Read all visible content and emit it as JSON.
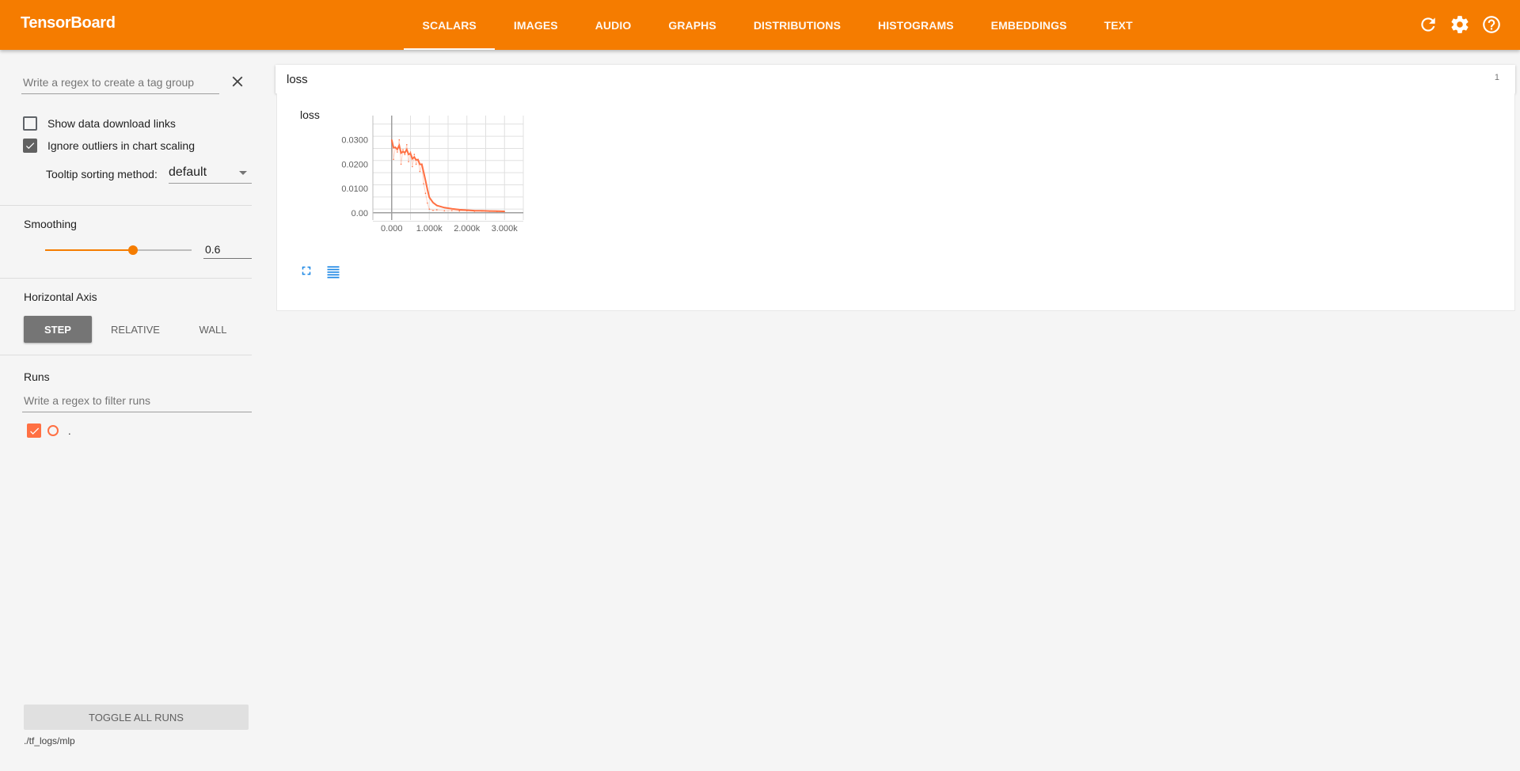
{
  "header": {
    "brand": "TensorBoard",
    "tabs": [
      {
        "label": "SCALARS",
        "active": true
      },
      {
        "label": "IMAGES"
      },
      {
        "label": "AUDIO"
      },
      {
        "label": "GRAPHS"
      },
      {
        "label": "DISTRIBUTIONS"
      },
      {
        "label": "HISTOGRAMS"
      },
      {
        "label": "EMBEDDINGS"
      },
      {
        "label": "TEXT"
      }
    ],
    "icons": [
      "refresh-icon",
      "settings-gear-icon",
      "help-icon"
    ]
  },
  "sidebar": {
    "tag_group_placeholder": "Write a regex to create a tag group",
    "show_download_links": {
      "label": "Show data download links",
      "checked": false
    },
    "ignore_outliers": {
      "label": "Ignore outliers in chart scaling",
      "checked": true
    },
    "tooltip_sorting": {
      "label": "Tooltip sorting method:",
      "value": "default"
    },
    "smoothing": {
      "label": "Smoothing",
      "value": "0.6",
      "fraction": 0.6
    },
    "horizontal_axis": {
      "label": "Horizontal Axis",
      "options": [
        "STEP",
        "RELATIVE",
        "WALL"
      ],
      "selected": "STEP"
    },
    "runs": {
      "label": "Runs",
      "filter_placeholder": "Write a regex to filter runs",
      "items": [
        {
          "name": ".",
          "checked": true,
          "color": "#ff7043"
        }
      ]
    },
    "toggle_all_runs": "TOGGLE ALL RUNS",
    "logdir": "./tf_logs/mlp"
  },
  "main": {
    "category": {
      "title": "loss",
      "count": "1"
    },
    "card": {
      "title": "loss"
    }
  },
  "colors": {
    "accent": "#f57c00",
    "run": "#ff7043"
  },
  "chart_data": {
    "type": "line",
    "title": "loss",
    "xlabel": "",
    "ylabel": "",
    "x_ticks": [
      "0.000",
      "1.000k",
      "2.000k",
      "3.000k"
    ],
    "y_ticks": [
      "0.00",
      "0.0100",
      "0.0200",
      "0.0300"
    ],
    "xlim": [
      -500,
      3500
    ],
    "ylim": [
      -0.003,
      0.04
    ],
    "grid": true,
    "series": [
      {
        "name": ".",
        "x": [
          0,
          50,
          100,
          150,
          200,
          250,
          300,
          350,
          400,
          450,
          500,
          550,
          600,
          650,
          700,
          750,
          800,
          850,
          900,
          950,
          1000,
          1100,
          1200,
          1400,
          1600,
          1800,
          2000,
          2200,
          2400,
          2600,
          2800,
          3000
        ],
        "y": [
          0.03,
          0.022,
          0.027,
          0.025,
          0.03,
          0.02,
          0.026,
          0.024,
          0.028,
          0.021,
          0.025,
          0.019,
          0.024,
          0.02,
          0.022,
          0.017,
          0.02,
          0.012,
          0.008,
          0.004,
          0.0015,
          0.001,
          0.0012,
          0.0008,
          0.0009,
          0.0007,
          0.0008,
          0.0006,
          0.0007,
          0.0006,
          0.0005,
          0.0005
        ]
      }
    ]
  }
}
